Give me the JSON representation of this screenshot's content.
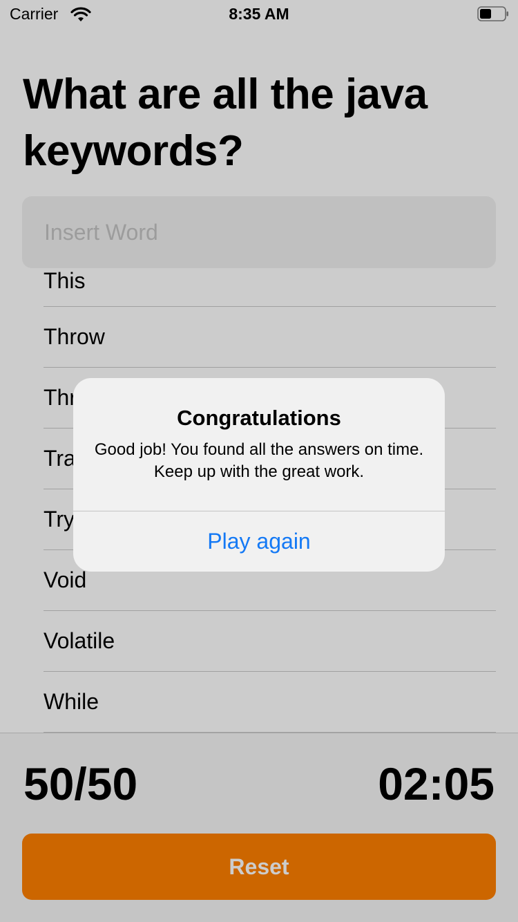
{
  "status_bar": {
    "carrier": "Carrier",
    "time": "8:35 AM",
    "icons": [
      "wifi-icon",
      "battery-icon"
    ]
  },
  "quiz": {
    "title": "What are all the java keywords?",
    "input_placeholder": "Insert Word",
    "input_value": ""
  },
  "answers": [
    "This",
    "Throw",
    "Throws",
    "Transient",
    "Try",
    "Void",
    "Volatile",
    "While"
  ],
  "footer": {
    "score": "50/50",
    "timer": "02:05",
    "reset_label": "Reset"
  },
  "alert": {
    "title": "Congratulations",
    "message": "Good job! You found all the answers on time. Keep up with the great work.",
    "button_label": "Play again"
  },
  "colors": {
    "accent": "#ff8000",
    "link": "#1479f5",
    "input_background": "#f1f1f1"
  }
}
